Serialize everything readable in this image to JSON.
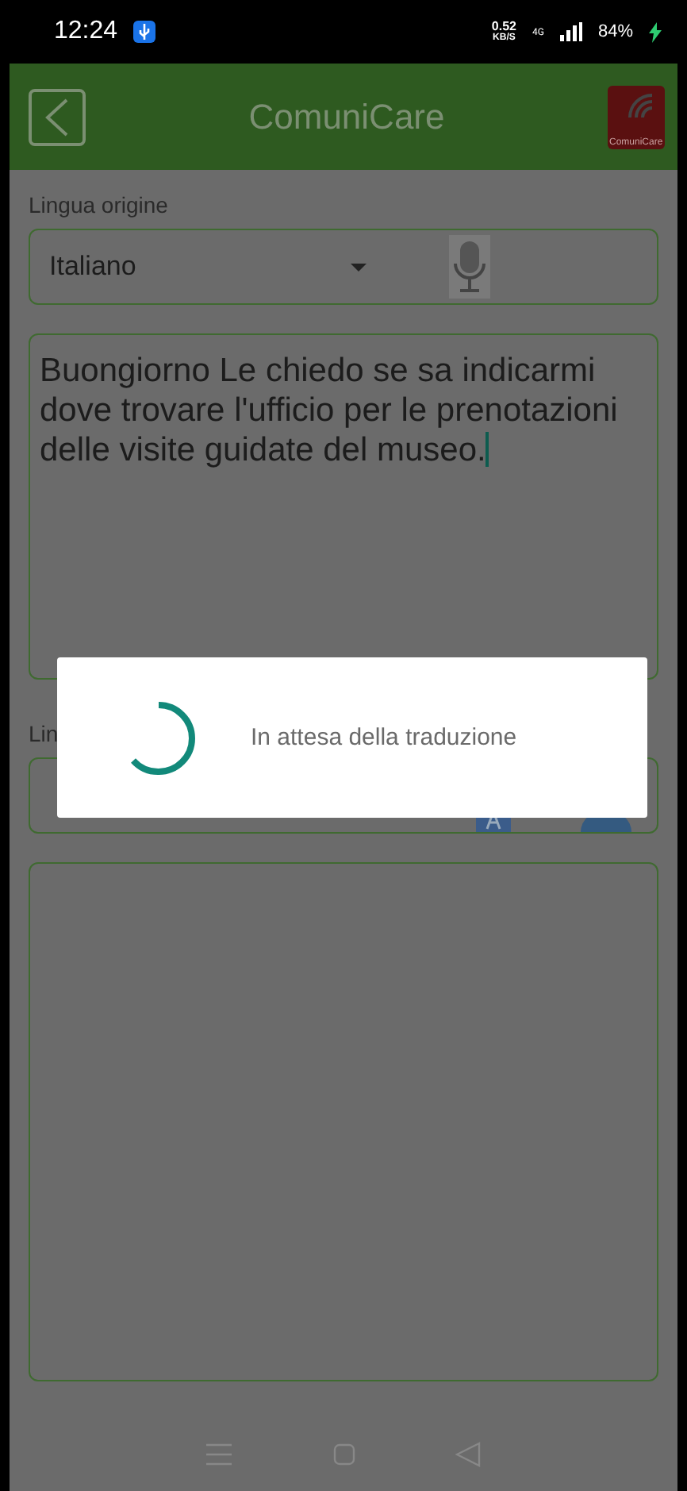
{
  "status_bar": {
    "time": "12:24",
    "speed": "0.52",
    "speed_unit": "KB/S",
    "network": "4G",
    "battery": "84%"
  },
  "app_bar": {
    "title": "ComuniCare",
    "logo_text": "ComuniCare"
  },
  "source": {
    "label": "Lingua origine",
    "language": "Italiano",
    "text": "Buongiorno Le chiedo se sa indicarmi dove trovare l'ufficio per le prenotazioni delle visite guidate del museo."
  },
  "target": {
    "label": "Lin"
  },
  "dialog": {
    "message": "In attesa della traduzione"
  }
}
